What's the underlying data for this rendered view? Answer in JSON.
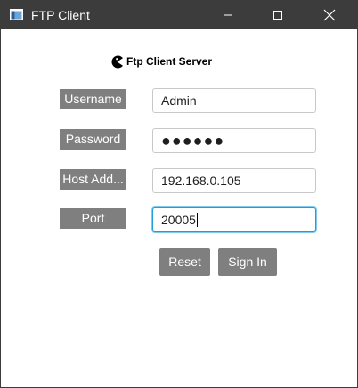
{
  "window": {
    "title": "FTP Client",
    "titlebar_color": "#3c3c3c"
  },
  "brand": {
    "text": "Ftp Client Server",
    "icon": "pacman-logo-icon"
  },
  "form": {
    "username": {
      "label": "Username",
      "value": "Admin"
    },
    "password": {
      "label": "Password",
      "value": "●●●●●●"
    },
    "host": {
      "label": "Host Add...",
      "value": "192.168.0.105"
    },
    "port": {
      "label": "Port",
      "value": "20005"
    }
  },
  "buttons": {
    "reset": "Reset",
    "sign_in": "Sign In"
  },
  "colors": {
    "label_bg": "#7f7f7f",
    "focus_border": "#1f9ede"
  }
}
